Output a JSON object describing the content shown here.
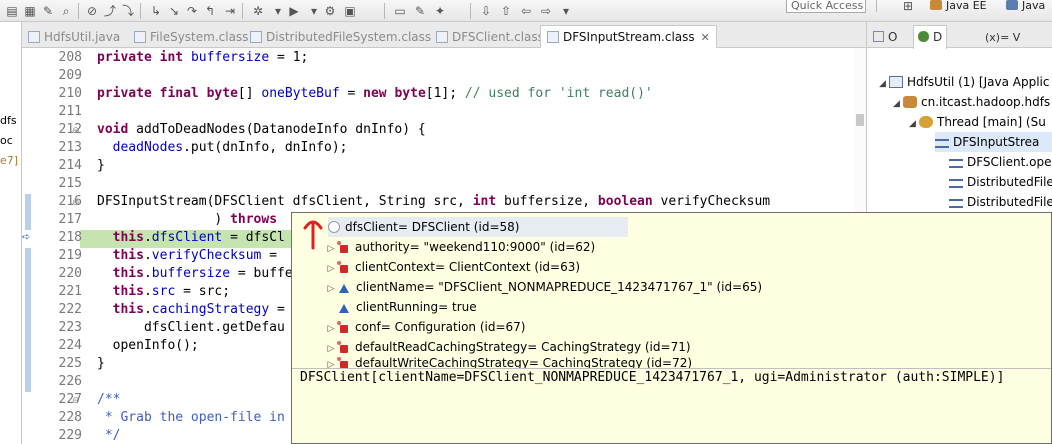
{
  "toolbar": {
    "quick_access_placeholder": "Quick Access",
    "perspectives": [
      {
        "label": "Java EE",
        "icon": "java-ee-perspective-icon"
      },
      {
        "label": "Java",
        "icon": "java-perspective-icon"
      }
    ]
  },
  "left_pane": {
    "fragments": [
      "dfs",
      "oc",
      "e7]"
    ]
  },
  "editor_tabs": [
    {
      "label": "HdfsUtil.java",
      "active": false
    },
    {
      "label": "FileSystem.class",
      "active": false
    },
    {
      "label": "DistributedFileSystem.class",
      "active": false
    },
    {
      "label": "DFSClient.class",
      "active": false
    },
    {
      "label": "DFSInputStream.class",
      "active": true
    }
  ],
  "editor": {
    "line_numbers": [
      "208",
      "209",
      "210",
      "211",
      "212",
      "213",
      "214",
      "215",
      "216",
      "217",
      "218",
      "219",
      "220",
      "221",
      "222",
      "223",
      "224",
      "225",
      "226",
      "227",
      "228",
      "229"
    ],
    "current_line": "218"
  },
  "right_pane": {
    "tabs": [
      {
        "label": "O",
        "icon": "outline-icon"
      },
      {
        "label": "D",
        "icon": "debug-icon"
      },
      {
        "label": "(x)= V",
        "icon": "variables-icon"
      }
    ],
    "tree": [
      {
        "label": "HdfsUtil (1) [Java Applic",
        "icon": "launch-icon",
        "indent": 1
      },
      {
        "label": "cn.itcast.hadoop.hdfs",
        "icon": "debug-target-icon",
        "indent": 2
      },
      {
        "label": "Thread [main] (Su",
        "icon": "thread-icon",
        "indent": 3
      },
      {
        "label": "DFSInputStrea",
        "icon": "stack-frame-icon",
        "indent": 4,
        "selected": true
      },
      {
        "label": "DFSClient.ope",
        "icon": "stack-frame-icon",
        "indent": 4
      },
      {
        "label": "DistributedFile",
        "icon": "stack-frame-icon",
        "indent": 4
      },
      {
        "label": "DistributedFile",
        "icon": "stack-frame-icon",
        "indent": 4
      }
    ]
  },
  "inspect_popup": {
    "root": "dfsClient= DFSClient  (id=58)",
    "children": [
      {
        "label": "authority= \"weekend110:9000\" (id=62)",
        "kind": "private",
        "expandable": true
      },
      {
        "label": "clientContext= ClientContext  (id=63)",
        "kind": "private",
        "expandable": true
      },
      {
        "label": "clientName= \"DFSClient_NONMAPREDUCE_1423471767_1\" (id=65)",
        "kind": "public",
        "expandable": true
      },
      {
        "label": "clientRunning= true",
        "kind": "public",
        "expandable": false
      },
      {
        "label": "conf= Configuration  (id=67)",
        "kind": "private",
        "expandable": true
      },
      {
        "label": "defaultReadCachingStrategy= CachingStrategy  (id=71)",
        "kind": "private",
        "expandable": true
      },
      {
        "label": "defaultWriteCachingStrategy= CachingStrategy  (id=72)",
        "kind": "private",
        "expandable": true
      }
    ],
    "detail": "DFSClient[clientName=DFSClient_NONMAPREDUCE_1423471767_1, ugi=Administrator (auth:SIMPLE)]"
  },
  "colors": {
    "keyword": "#7f0055",
    "field": "#0000c0",
    "comment": "#3f7f5f",
    "javadoc": "#3f5fbf",
    "debug_line_highlight": "#c6e4b0",
    "popup_background": "#ffffe1",
    "annotation_arrow": "#e02020"
  }
}
